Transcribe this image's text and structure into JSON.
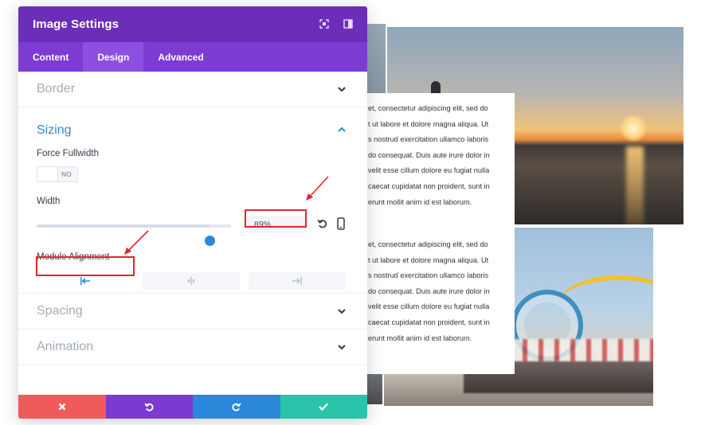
{
  "modal": {
    "title": "Image Settings",
    "header_icons": [
      "expand-icon",
      "split-view-icon"
    ],
    "tabs": [
      {
        "label": "Content",
        "active": false
      },
      {
        "label": "Design",
        "active": true
      },
      {
        "label": "Advanced",
        "active": false
      }
    ],
    "sections": {
      "border": {
        "title": "Border",
        "expanded": false
      },
      "sizing": {
        "title": "Sizing",
        "expanded": true,
        "force_fullwidth": {
          "label": "Force Fullwidth",
          "value": "NO"
        },
        "width": {
          "label": "Width",
          "value": "89%",
          "slider_fraction": 0.89
        },
        "module_alignment": {
          "label": "Module Alignment",
          "options": [
            "left",
            "center",
            "right"
          ],
          "selected": "left"
        }
      },
      "spacing": {
        "title": "Spacing",
        "expanded": false
      },
      "animation": {
        "title": "Animation",
        "expanded": false
      }
    },
    "footer": {
      "buttons": [
        "discard",
        "undo",
        "redo",
        "save"
      ]
    },
    "colors": {
      "header": "#6c2eb9",
      "tabs": "#7d3bd4",
      "active_section": "#2d8ac8",
      "discard": "#ef5a5a",
      "undo": "#7b3bd2",
      "redo": "#2b87da",
      "save": "#29c4a9",
      "highlight": "#e8242b"
    }
  },
  "background": {
    "text_block_1": [
      "et, consectetur adipiscing elit, sed do",
      "t ut labore et dolore magna aliqua. Ut",
      "s nostrud exercitation ullamco laboris",
      "do consequat. Duis aute irure dolor in",
      "velit esse cillum dolore eu fugiat nulla",
      "caecat cupidatat non proident, sunt in",
      "erunt mollit anim id est laborum."
    ],
    "text_block_2": [
      "et, consectetur adipiscing elit, sed do",
      "t ut labore et dolore magna aliqua. Ut",
      "s nostrud exercitation ullamco laboris",
      "do consequat. Duis aute irure dolor in",
      "velit esse cillum dolore eu fugiat nulla",
      "caecat cupidatat non proident, sunt in",
      "erunt mollit anim id est laborum."
    ]
  }
}
